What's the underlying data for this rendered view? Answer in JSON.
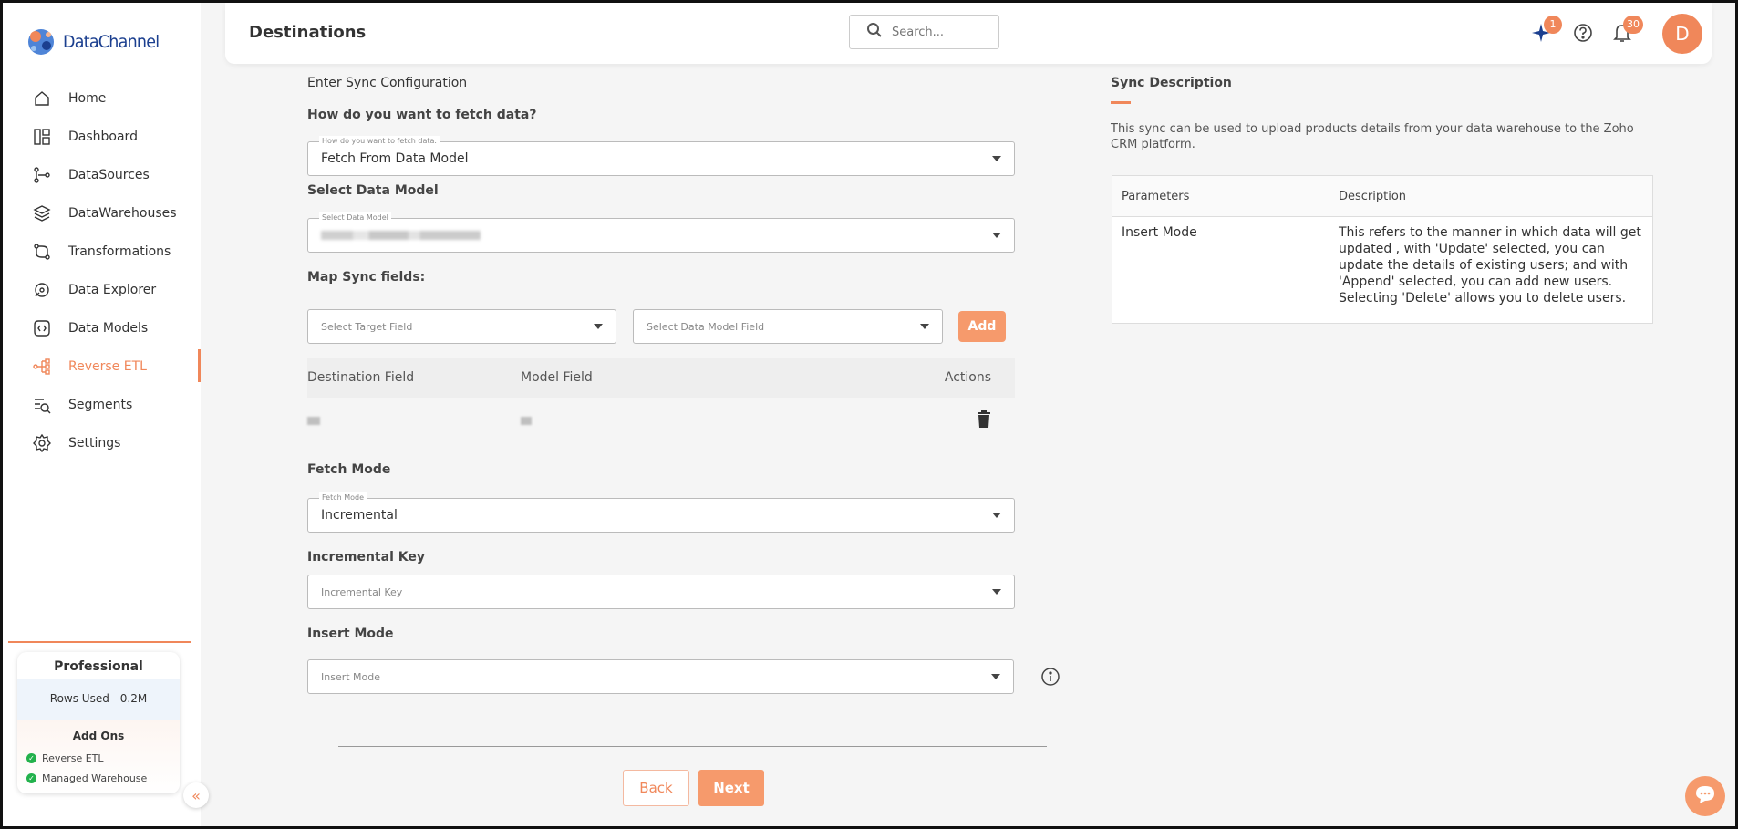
{
  "app": {
    "name": "DataChannel"
  },
  "sidebar": {
    "items": [
      {
        "label": "Home",
        "icon": "home-icon"
      },
      {
        "label": "Dashboard",
        "icon": "dashboard-icon"
      },
      {
        "label": "DataSources",
        "icon": "datasources-icon"
      },
      {
        "label": "DataWarehouses",
        "icon": "layers-icon"
      },
      {
        "label": "Transformations",
        "icon": "transform-icon"
      },
      {
        "label": "Data Explorer",
        "icon": "explorer-icon"
      },
      {
        "label": "Data Models",
        "icon": "data-models-icon"
      },
      {
        "label": "Reverse ETL",
        "icon": "reverse-etl-icon",
        "active": true
      },
      {
        "label": "Segments",
        "icon": "segments-icon"
      },
      {
        "label": "Settings",
        "icon": "gear-icon"
      }
    ],
    "plan": {
      "name": "Professional",
      "rows_used": "Rows Used - 0.2M",
      "addons_title": "Add Ons",
      "addons": [
        "Reverse ETL",
        "Managed Warehouse"
      ]
    }
  },
  "header": {
    "title": "Destinations",
    "search_placeholder": "Search...",
    "ai_badge": "1",
    "notification_badge": "30",
    "avatar_initial": "D"
  },
  "form": {
    "section_title": "Enter Sync Configuration",
    "fetch_question": "How do you want to fetch data?",
    "fetch_float_label": "How do you want to fetch data.",
    "fetch_value": "Fetch From Data Model",
    "data_model_label": "Select Data Model",
    "data_model_float_label": "Select Data Model",
    "map_label": "Map Sync fields:",
    "target_field_placeholder": "Select Target Field",
    "model_field_placeholder": "Select Data Model Field",
    "add_label": "Add",
    "table_headers": {
      "destination": "Destination Field",
      "model": "Model Field",
      "actions": "Actions"
    },
    "fetch_mode_label": "Fetch Mode",
    "fetch_mode_float_label": "Fetch Mode",
    "fetch_mode_value": "Incremental",
    "incremental_key_label": "Incremental Key",
    "incremental_key_placeholder": "Incremental Key",
    "insert_mode_label": "Insert Mode",
    "insert_mode_placeholder": "Insert Mode",
    "back_label": "Back",
    "next_label": "Next"
  },
  "description": {
    "title": "Sync Description",
    "text": "This sync can be used to upload products details from your data warehouse to the Zoho CRM platform.",
    "table_headers": [
      "Parameters",
      "Description"
    ],
    "rows": [
      {
        "parameter": "Insert Mode",
        "description": "This refers to the manner in which data will get updated , with 'Update' selected, you can update the details of existing users; and with 'Append' selected, you can add new users. Selecting 'Delete' allows you to delete users."
      }
    ]
  },
  "colors": {
    "accent": "#f0875a",
    "brand": "#1b3f8f"
  }
}
